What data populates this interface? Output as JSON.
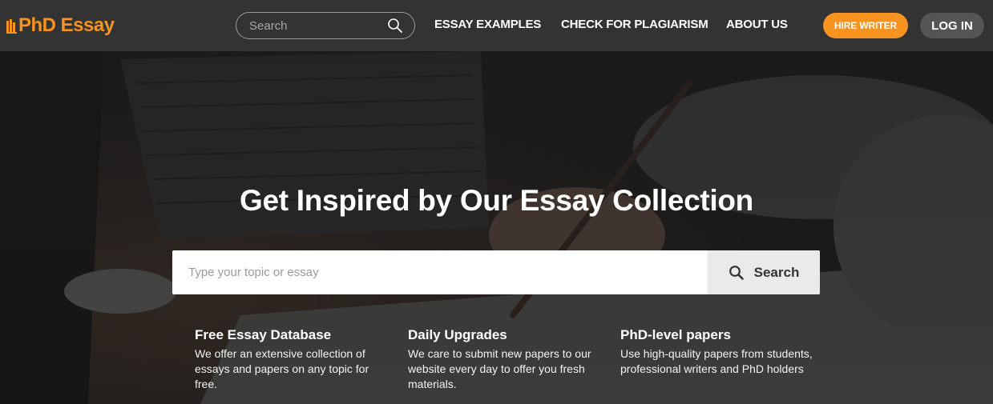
{
  "header": {
    "logo_text": "PhD Essay",
    "search": {
      "placeholder": "Search"
    },
    "nav": [
      {
        "label": "ESSAY EXAMPLES"
      },
      {
        "label": "CHECK FOR PLAGIARISM"
      },
      {
        "label": "ABOUT US"
      }
    ],
    "hire_label": "HIRE WRITER",
    "login_label": "LOG IN"
  },
  "hero": {
    "title": "Get Inspired by Our Essay Collection",
    "search": {
      "placeholder": "Type your topic or essay",
      "button_label": "Search"
    },
    "features": [
      {
        "title": "Free Essay Database",
        "text": "We offer an extensive collection of essays and papers on any topic for free."
      },
      {
        "title": "Daily Upgrades",
        "text": "We care to submit new papers to our website every day to offer you fresh materials."
      },
      {
        "title": "PhD-level papers",
        "text": "Use high-quality papers from students, professional writers and PhD holders"
      }
    ]
  },
  "colors": {
    "accent": "#f7931e",
    "header_bg": "#333333",
    "login_bg": "#555555"
  },
  "icons": [
    "search-icon",
    "logo-mark-icon"
  ]
}
